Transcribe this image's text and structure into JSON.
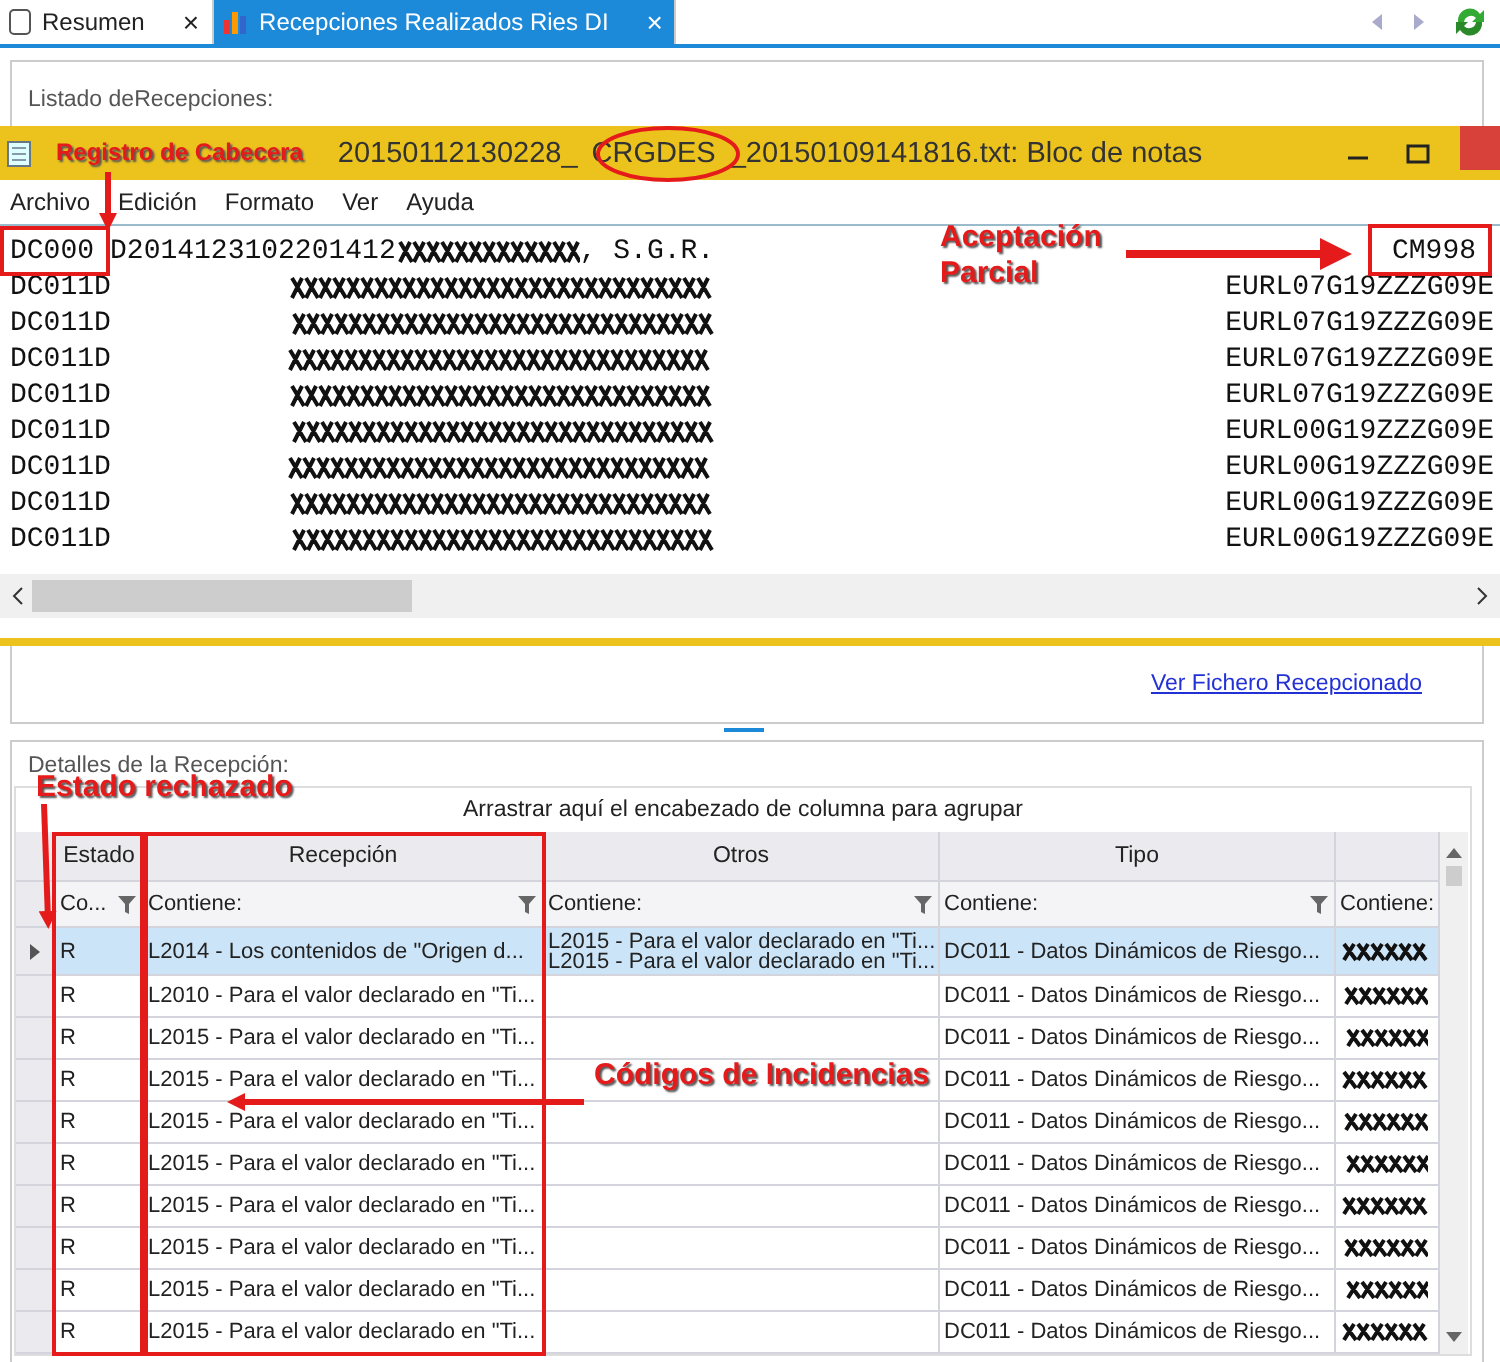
{
  "tabs": [
    {
      "label": "Resumen",
      "selected": false,
      "close": "×"
    },
    {
      "label": "Recepciones Realizados Ries DI",
      "selected": true,
      "close": "×"
    }
  ],
  "list_panel": {
    "label": "Listado deRecepciones:"
  },
  "notepad": {
    "title_parts": [
      "20150112130228_",
      "CRGDES",
      "_20150109141816.txt: Bloc de notas"
    ],
    "menu": [
      "Archivo",
      "Edición",
      "Formato",
      "Ver",
      "Ayuda"
    ],
    "lines": [
      {
        "kind": "header",
        "code": "DC000",
        "code_rest": "D2014123102201412",
        "tail": ", S.G.R.",
        "end": "CM998"
      },
      {
        "kind": "detail",
        "code": "DC011D",
        "end": "EURL07G19ZZZG09E"
      },
      {
        "kind": "detail",
        "code": "DC011D",
        "end": "EURL07G19ZZZG09E"
      },
      {
        "kind": "detail",
        "code": "DC011D",
        "end": "EURL07G19ZZZG09E"
      },
      {
        "kind": "detail",
        "code": "DC011D",
        "end": "EURL07G19ZZZG09E"
      },
      {
        "kind": "detail",
        "code": "DC011D",
        "end": "EURL00G19ZZZG09E"
      },
      {
        "kind": "detail",
        "code": "DC011D",
        "end": "EURL00G19ZZZG09E"
      },
      {
        "kind": "detail",
        "code": "DC011D",
        "end": "EURL00G19ZZZG09E"
      },
      {
        "kind": "detail",
        "code": "DC011D",
        "end": "EURL00G19ZZZG09E"
      }
    ]
  },
  "link": "Ver Fichero Recepcionado",
  "details": {
    "label": "Detalles de la Recepción:",
    "group_hint": "Arrastrar aquí el encabezado de columna para agrupar",
    "columns": [
      {
        "header": "Estado",
        "filter": "Co..."
      },
      {
        "header": "Recepción",
        "filter": "Contiene:"
      },
      {
        "header": "Otros",
        "filter": "Contiene:"
      },
      {
        "header": "Tipo",
        "filter": "Contiene:"
      },
      {
        "filter": "Contiene:"
      }
    ],
    "rows": [
      {
        "selected": true,
        "estado": "R",
        "recepcion": "L2014 - Los contenidos de \"Origen d...",
        "otros": [
          "L2015 - Para el valor declarado en \"Ti...",
          "L2015 - Para el valor declarado en \"Ti..."
        ],
        "tipo": "DC011 - Datos Dinámicos de Riesgo..."
      },
      {
        "selected": false,
        "estado": "R",
        "recepcion": "L2010 - Para el valor declarado en \"Ti...",
        "tipo": "DC011 - Datos Dinámicos de Riesgo..."
      },
      {
        "selected": false,
        "estado": "R",
        "recepcion": "L2015 - Para el valor declarado en \"Ti...",
        "tipo": "DC011 - Datos Dinámicos de Riesgo..."
      },
      {
        "selected": false,
        "estado": "R",
        "recepcion": "L2015 - Para el valor declarado en \"Ti...",
        "tipo": "DC011 - Datos Dinámicos de Riesgo..."
      },
      {
        "selected": false,
        "estado": "R",
        "recepcion": "L2015 - Para el valor declarado en \"Ti...",
        "tipo": "DC011 - Datos Dinámicos de Riesgo..."
      },
      {
        "selected": false,
        "estado": "R",
        "recepcion": "L2015 - Para el valor declarado en \"Ti...",
        "tipo": "DC011 - Datos Dinámicos de Riesgo..."
      },
      {
        "selected": false,
        "estado": "R",
        "recepcion": "L2015 - Para el valor declarado en \"Ti...",
        "tipo": "DC011 - Datos Dinámicos de Riesgo..."
      },
      {
        "selected": false,
        "estado": "R",
        "recepcion": "L2015 - Para el valor declarado en \"Ti...",
        "tipo": "DC011 - Datos Dinámicos de Riesgo..."
      },
      {
        "selected": false,
        "estado": "R",
        "recepcion": "L2015 - Para el valor declarado en \"Ti...",
        "tipo": "DC011 - Datos Dinámicos de Riesgo..."
      },
      {
        "selected": false,
        "estado": "R",
        "recepcion": "L2015 - Para el valor declarado en \"Ti...",
        "tipo": "DC011 - Datos Dinámicos de Riesgo..."
      }
    ]
  },
  "annotations": [
    {
      "text": "Registro de Cabecera"
    },
    {
      "text": "Aceptación Parcial"
    },
    {
      "text": "Estado rechazado"
    },
    {
      "text": "Códigos de Incidencias"
    }
  ]
}
